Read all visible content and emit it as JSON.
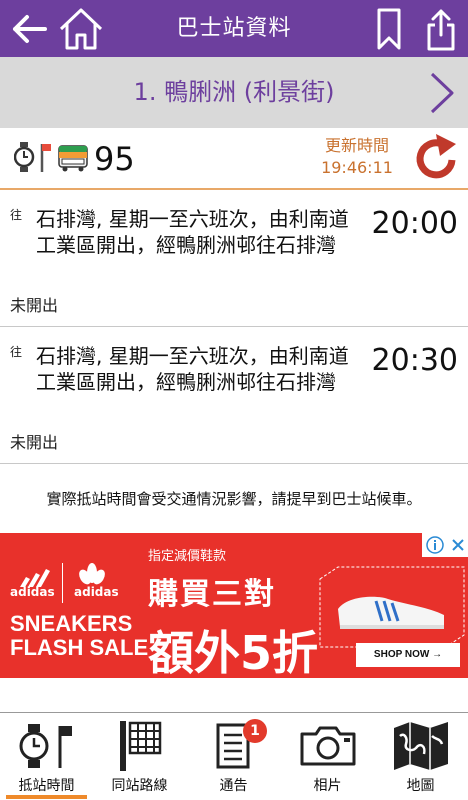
{
  "header": {
    "title": "巴士站資料",
    "back_icon": "arrow-left-icon",
    "home_icon": "home-icon",
    "bookmark_icon": "bookmark-icon",
    "share_icon": "share-icon"
  },
  "stop": {
    "name": "1. 鴨脷洲 (利景街)",
    "next_icon": "chevron-right-icon"
  },
  "route": {
    "number": "95",
    "update_label": "更新時間",
    "update_time": "19:46:11"
  },
  "etas": [
    {
      "direction": "往",
      "description": "石排灣, 星期一至六班次，由利南道工業區開出，經鴨脷洲邨往石排灣",
      "time": "20:00",
      "status": "未開出"
    },
    {
      "direction": "往",
      "description": "石排灣, 星期一至六班次，由利南道工業區開出，經鴨脷洲邨往石排灣",
      "time": "20:30",
      "status": "未開出"
    }
  ],
  "notice": "實際抵站時間會受交通情況影響，請提早到巴士站候車。",
  "ad": {
    "brand1": "adidas",
    "brand2": "adidas",
    "promo_small": "指定減價鞋款",
    "promo_big": "購買三對",
    "headline1": "SNEAKERS",
    "headline2": "FLASH SALE",
    "discount": "額外5折",
    "cta": "SHOP NOW →"
  },
  "bottom_nav": [
    {
      "label": "抵站時間",
      "icon": "stop-eta-icon",
      "active": true
    },
    {
      "label": "同站路線",
      "icon": "route-list-icon",
      "active": false
    },
    {
      "label": "通告",
      "icon": "notice-icon",
      "active": false,
      "badge": "1"
    },
    {
      "label": "相片",
      "icon": "camera-icon",
      "active": false
    },
    {
      "label": "地圖",
      "icon": "map-icon",
      "active": false
    }
  ],
  "colors": {
    "header": "#6d3f9e",
    "accent_orange": "#c9722f",
    "refresh": "#c0392b",
    "ad_red": "#e8312b"
  }
}
